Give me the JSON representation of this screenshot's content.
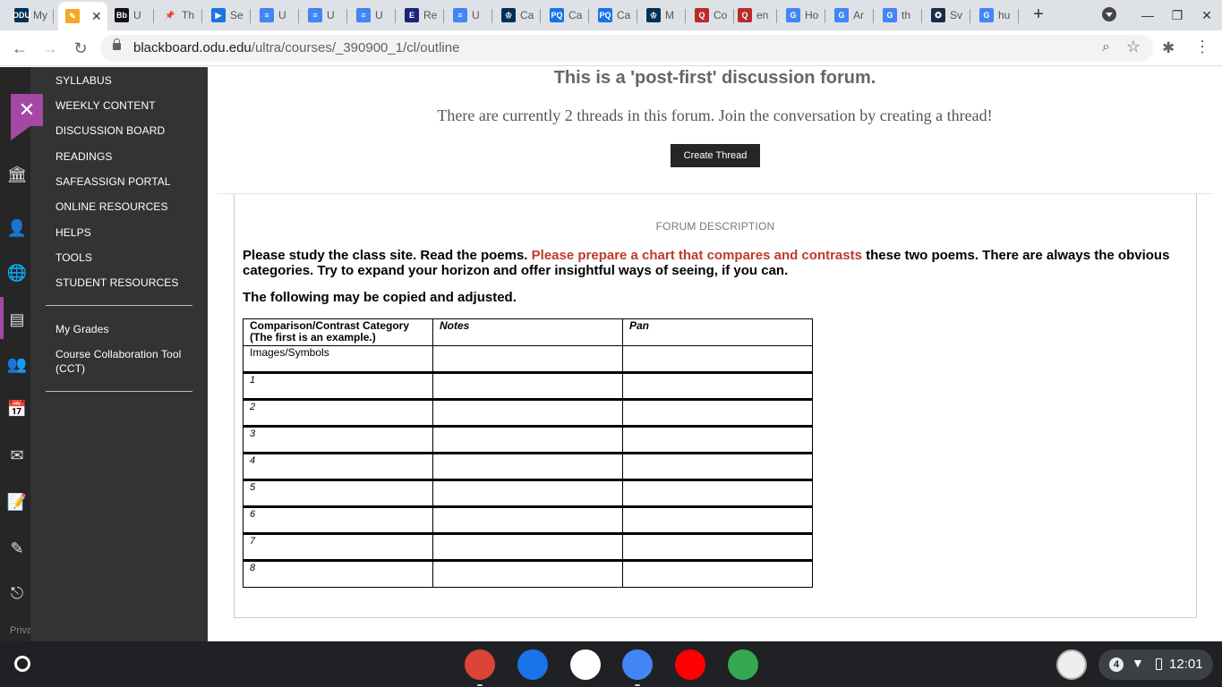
{
  "browser": {
    "tabs": [
      {
        "title": "My",
        "favicon": "ODU",
        "color": "#003057"
      },
      {
        "title": "",
        "favicon": "✎",
        "color": "#f5a623"
      },
      {
        "title": "U",
        "favicon": "Bb",
        "color": "#111111"
      },
      {
        "title": "Th",
        "favicon": "📌",
        "color": "#dee1e6"
      },
      {
        "title": "Se",
        "favicon": "▶",
        "color": "#1a73e8"
      },
      {
        "title": "U",
        "favicon": "≡",
        "color": "#4285f4"
      },
      {
        "title": "U",
        "favicon": "≡",
        "color": "#4285f4"
      },
      {
        "title": "U",
        "favicon": "≡",
        "color": "#4285f4"
      },
      {
        "title": "Re",
        "favicon": "E",
        "color": "#1a237e"
      },
      {
        "title": "U",
        "favicon": "≡",
        "color": "#4285f4"
      },
      {
        "title": "Ca",
        "favicon": "♔",
        "color": "#003057"
      },
      {
        "title": "Ca",
        "favicon": "PQ",
        "color": "#1a73e8"
      },
      {
        "title": "Ca",
        "favicon": "PQ",
        "color": "#1a73e8"
      },
      {
        "title": "M",
        "favicon": "♔",
        "color": "#003057"
      },
      {
        "title": "Co",
        "favicon": "Q",
        "color": "#b92b27"
      },
      {
        "title": "en",
        "favicon": "Q",
        "color": "#b92b27"
      },
      {
        "title": "Ho",
        "favicon": "G",
        "color": "#4285f4"
      },
      {
        "title": "Ar",
        "favicon": "G",
        "color": "#4285f4"
      },
      {
        "title": "th",
        "favicon": "G",
        "color": "#4285f4"
      },
      {
        "title": "Sv",
        "favicon": "✪",
        "color": "#1c2b4a"
      },
      {
        "title": "hu",
        "favicon": "G",
        "color": "#4285f4"
      }
    ],
    "active_tab_index": 1,
    "close_glyph": "✕",
    "new_tab_glyph": "+",
    "url_host": "blackboard.odu.edu",
    "url_path": "/ultra/courses/_390900_1/cl/outline"
  },
  "course_menu": {
    "items": [
      "SYLLABUS",
      "WEEKLY CONTENT",
      "DISCUSSION BOARD",
      "READINGS",
      "SAFEASSIGN PORTAL",
      "ONLINE RESOURCES",
      "HELPS",
      "TOOLS",
      "STUDENT RESOURCES"
    ],
    "tools": [
      "My Grades",
      "Course Collaboration Tool (CCT)"
    ]
  },
  "rail": {
    "icons": [
      "institution-icon",
      "profile-icon",
      "globe-icon",
      "courses-icon",
      "groups-icon",
      "calendar-icon",
      "messages-icon",
      "grades-icon",
      "tools-icon",
      "sign-out-icon"
    ],
    "privacy": "Priva"
  },
  "forum": {
    "title": "This is a 'post-first' discussion forum.",
    "subtitle": "There are currently 2 threads in this forum. Join the conversation by creating a thread!",
    "create_button": "Create Thread",
    "description_label": "FORUM DESCRIPTION",
    "text_before": "Please study the class site. Read the poems. ",
    "text_highlight": "Please prepare a chart that compares and contrasts",
    "text_after": " these two poems. There are always the obvious categories.  Try to expand your horizon and offer insightful ways of seeing, if you can.",
    "text_copy": "The following may be copied and adjusted.",
    "highlight_color": "#c0392b"
  },
  "table": {
    "headers": [
      "Comparison/Contrast Category (The first is an example.)",
      "Notes",
      "Pan"
    ],
    "example_row": "Images/Symbols",
    "numbered_rows": [
      "1",
      "2",
      "3",
      "4",
      "5",
      "6",
      "7",
      "8"
    ]
  },
  "shelf": {
    "apps": [
      {
        "name": "chrome-app",
        "color": "#db4437"
      },
      {
        "name": "files-app",
        "color": "#1a73e8"
      },
      {
        "name": "gmail-app",
        "color": "#ffffff"
      },
      {
        "name": "docs-app",
        "color": "#4285f4"
      },
      {
        "name": "youtube-app",
        "color": "#ff0000"
      },
      {
        "name": "play-store-app",
        "color": "#34a853"
      }
    ],
    "notification_count": "4",
    "time": "12:01"
  }
}
